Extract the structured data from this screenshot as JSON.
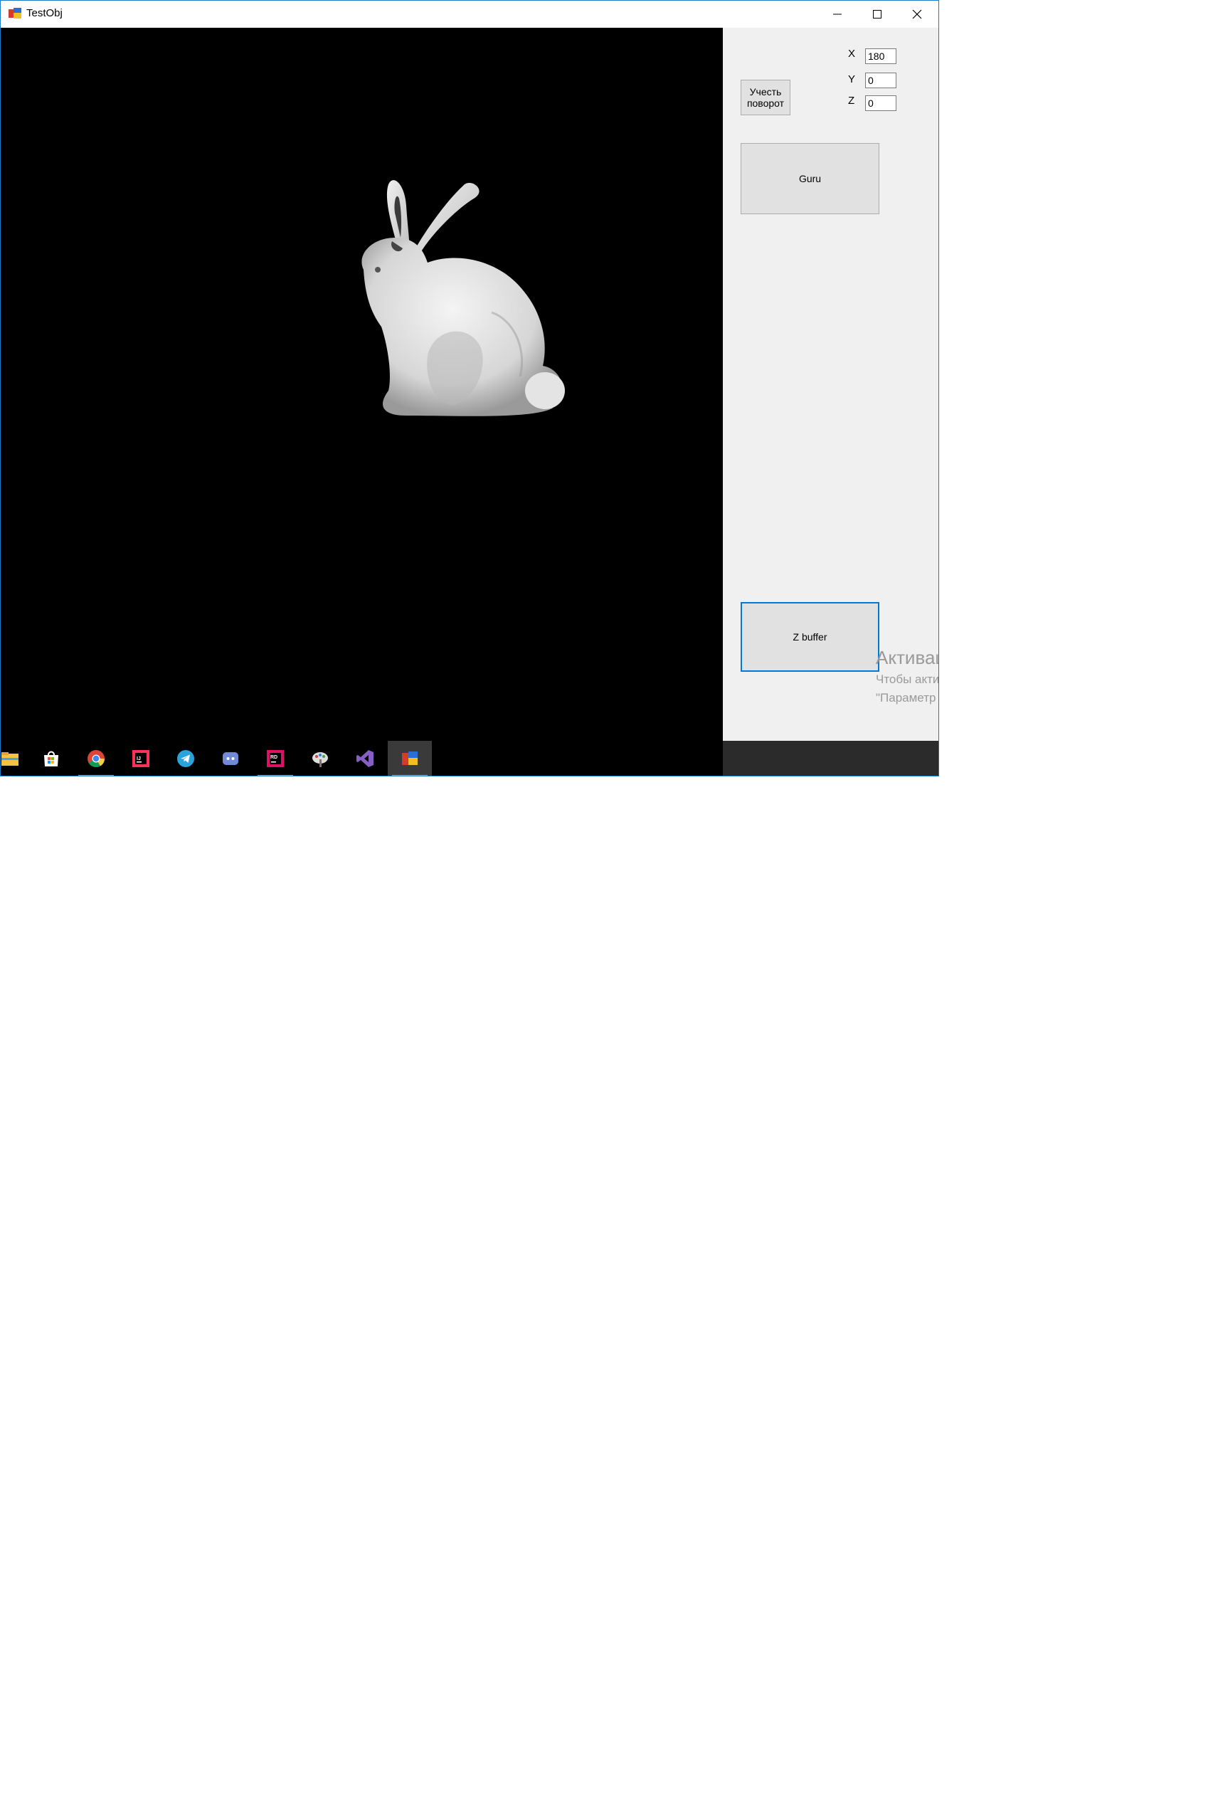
{
  "window": {
    "title": "TestObj"
  },
  "panel": {
    "x_label": "X",
    "y_label": "Y",
    "z_label": "Z",
    "x_value": "180",
    "y_value": "0",
    "z_value": "0",
    "rotate_button": "Учесть поворот",
    "guru_button": "Guru",
    "zbuffer_button": "Z buffer"
  },
  "activation": {
    "title": "Активац",
    "line1": "Чтобы акти",
    "line2": "\"Параметр"
  },
  "taskbar": {
    "icons": [
      "file-explorer-icon",
      "store-icon",
      "chrome-icon",
      "intellij-icon",
      "telegram-icon",
      "discord-icon",
      "rider-icon",
      "paint-icon",
      "visual-studio-icon",
      "testobj-app-icon"
    ]
  },
  "colors": {
    "viewport": "#000000",
    "panel": "#f0f0f0",
    "focus_border": "#0078d7",
    "taskbar_underline": "#76b9ed"
  }
}
